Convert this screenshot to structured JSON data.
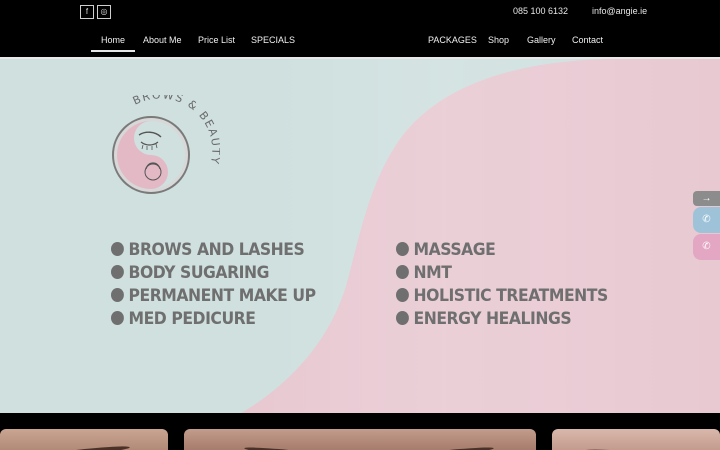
{
  "topbar": {
    "social": [
      {
        "icon": "facebook-icon",
        "glyph": "f"
      },
      {
        "icon": "instagram-icon",
        "glyph": "◎"
      }
    ],
    "phone": "085 100 6132",
    "email": "info@angie.ie"
  },
  "nav": {
    "left": [
      "Home",
      "About Me",
      "Price List",
      "SPECIALS"
    ],
    "right": [
      "PACKAGES",
      "Shop",
      "Gallery",
      "Contact"
    ],
    "active": "Home"
  },
  "hero": {
    "logo_text": "BROWS & BEAUTY",
    "services_left": [
      "BROWS AND LASHES",
      "BODY SUGARING",
      "PERMANENT MAKE UP",
      "MED PEDICURE"
    ],
    "services_right": [
      "MASSAGE",
      "NMT",
      "HOLISTIC TREATMENTS",
      "ENERGY HEALINGS"
    ],
    "colors": {
      "mint": "#cfe0df",
      "pink": "#e8c9d2",
      "text": "#6f6f6f"
    }
  },
  "side_buttons": [
    {
      "icon": "arrow-right-icon",
      "glyph": "→"
    },
    {
      "icon": "whatsapp-icon",
      "glyph": "✆"
    },
    {
      "icon": "phone-icon",
      "glyph": "✆"
    }
  ]
}
